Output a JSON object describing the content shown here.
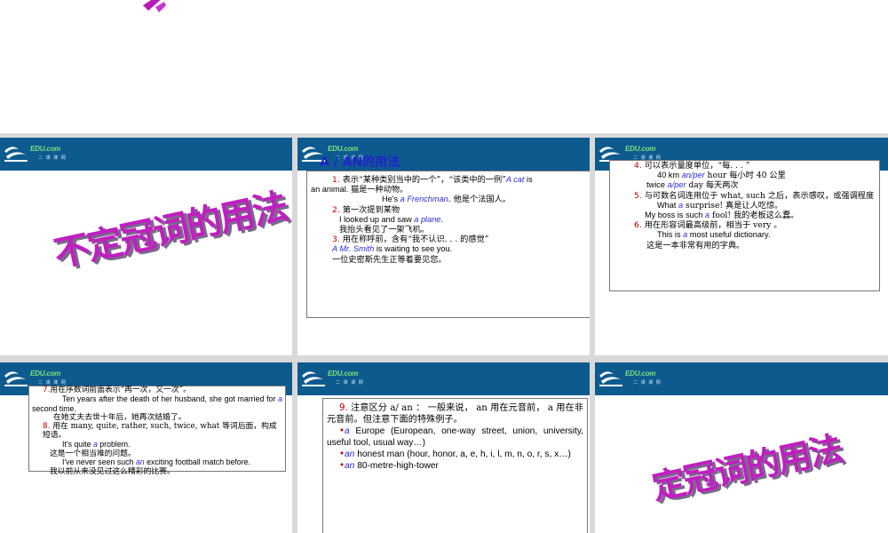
{
  "colors": {
    "banner": "#0d5a8f",
    "wordart": "#c01fc0",
    "red": "#c00000",
    "blue": "#2b2bd6"
  },
  "logo": {
    "text": "EDU.com",
    "sub": "二 课 课 网"
  },
  "slide1": {
    "title": "不定冠词的用法"
  },
  "slide2": {
    "heading": "A / AN的用法",
    "l1_num": "1.",
    "l1_text": "表示“某种类别当中的一个”，“该类中的一例”",
    "l1_en": "A cat",
    "l1_is": " is",
    "l1_tail": "an animal. 猫是一种动物。",
    "l2_pre": "He's ",
    "l2_en": "a Frenchman",
    "l2_cn": ". 他是个法国人。",
    "l3_num": "2.",
    "l3_text": "第一次提到某物",
    "l4_pre": "I looked up and saw ",
    "l4_en": "a plane",
    "l4_end": ".",
    "l5": "我抬头看见了一架飞机。",
    "l6_num": "3.",
    "l6_text": "用在称呼前，含有“我不认识. . . 的感觉”",
    "l7_en": "A Mr. Smith",
    "l7_rest": " is waiting to see you.",
    "l8": "一位史密斯先生正等着要见您。"
  },
  "slide3": {
    "l1_num": "4.",
    "l1_text": "可以表示量度单位，“每. . . ”",
    "l2_pre": "40 km ",
    "l2_en": "an/per",
    "l2_rest": " hour  每小时 40 公里",
    "l3_pre": "twice ",
    "l3_en": "a/per",
    "l3_rest": " day  每天两次",
    "l4_num": "5.",
    "l4_text": "与可数名词连用位于 what, such 之后，表示感叹，或强调程度",
    "l5_pre": "What ",
    "l5_en": "a",
    "l5_rest": " surprise!  真是让人吃惊。",
    "l6_pre": "My boss is such ",
    "l6_en": "a",
    "l6_rest": " fool!  我的老板这么蠢。",
    "l7_num": "6.",
    "l7_text": "用在形容词最高级前，相当于 very 。",
    "l8_pre": "This is ",
    "l8_en": "a",
    "l8_rest": " most useful dictionary.",
    "l9": "这是一本非常有用的字典。"
  },
  "slide4": {
    "l1_num": "7.",
    "l1_text": "用在序数词前面表示“再一次，又一次”。",
    "l2": "Ten years after the death of her husband, she got married for ",
    "l2_en": "a",
    "l2_rest": " second time.",
    "l3": "在她丈夫去世十年后，她再次结婚了。",
    "l4_num": "8.",
    "l4_text": "用在 many, quite, rather, such, twice,  what  等词后面，构成短语。",
    "l5_pre": "It's quite ",
    "l5_en": "a",
    "l5_rest": " problem.",
    "l6": "这是一个相当难的问题。",
    "l7_pre": "I've never seen such ",
    "l7_en": "an",
    "l7_rest": " exciting football match before.",
    "l8": "我以前从来没见过这么精彩的比赛。"
  },
  "slide5": {
    "l1_num": "9.",
    "l1_text": "注意区分 a/ an ： 一般来说， an 用在元音前， a 用在非元音前。但注意下面的特殊例子。",
    "b1_en": "a",
    "b1_rest": " Europe (European, one-way street, union, university, useful tool, usual way…)",
    "b2_en": "an",
    "b2_rest": " honest man (hour, honor, a, e, h, i, l, m, n, o, r, s, x…)",
    "b3_en": "an",
    "b3_rest": " 80-metre-high-tower",
    "bullet": "•"
  },
  "slide6": {
    "title": "定冠词的用法"
  }
}
